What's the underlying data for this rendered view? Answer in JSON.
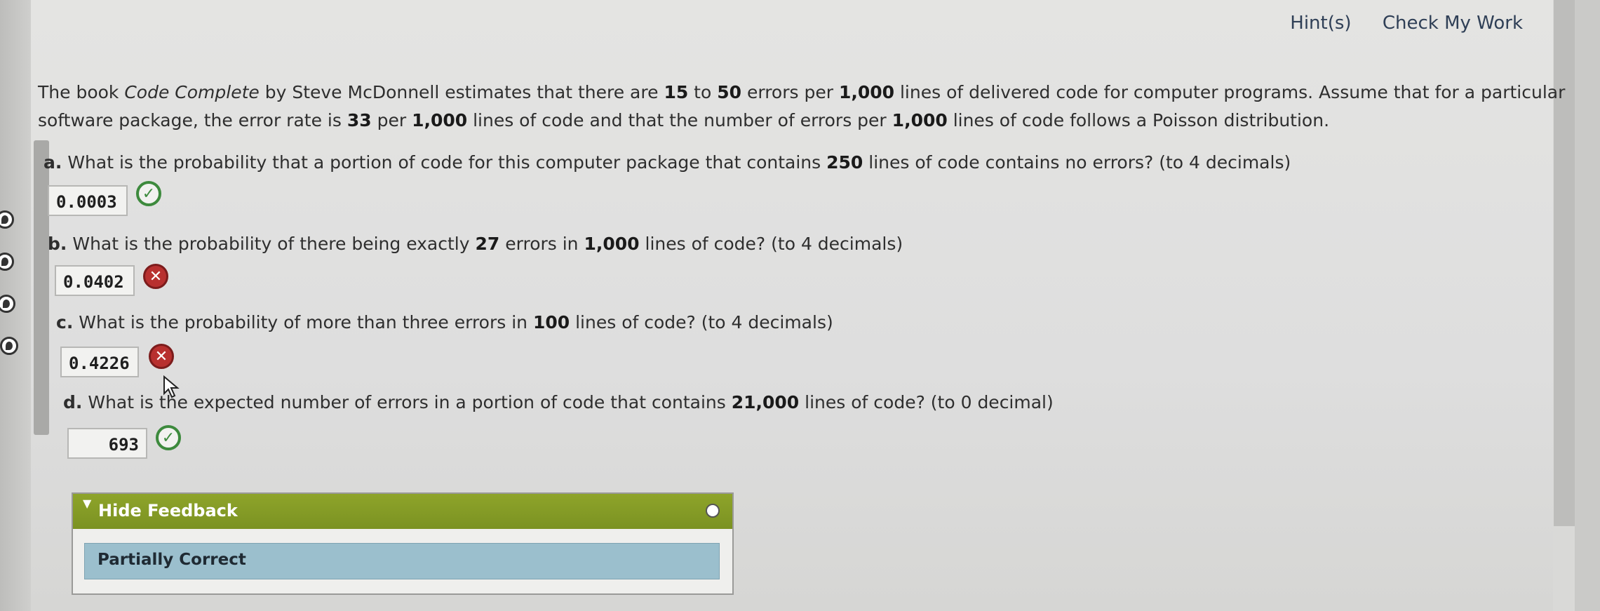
{
  "header": {
    "hints_link": "Hint(s)",
    "check_link": "Check My Work"
  },
  "problem": {
    "line1_parts": [
      "The book ",
      "Code Complete",
      " by Steve McDonnell estimates that there are ",
      "15",
      " to ",
      "50",
      " errors per ",
      "1,000",
      " lines of delivered code for computer programs. Assume that for a particular"
    ],
    "line2_parts": [
      "software package, the error rate is ",
      "33",
      " per ",
      "1,000",
      " lines of code and that the number of errors per ",
      "1,000",
      " lines of code follows a Poisson distribution."
    ]
  },
  "questions": [
    {
      "label": "a.",
      "parts": [
        " What is the probability that a portion of code for this computer package that contains ",
        "250",
        " lines of code contains no errors? (to 4 decimals)"
      ],
      "answer": "0.0003",
      "status": "correct"
    },
    {
      "label": "b.",
      "parts": [
        " What is the probability of there being exactly ",
        "27",
        " errors in ",
        "1,000",
        " lines of code? (to 4 decimals)"
      ],
      "answer": "0.0402",
      "status": "incorrect"
    },
    {
      "label": "c.",
      "parts": [
        " What is the probability of more than three errors in ",
        "100",
        " lines of code? (to 4 decimals)"
      ],
      "answer": "0.4226",
      "status": "incorrect"
    },
    {
      "label": "d.",
      "parts": [
        " What is the expected number of errors in a portion of code that contains ",
        "21,000",
        " lines of code? (to 0 decimal)"
      ],
      "answer": "693",
      "status": "correct"
    }
  ],
  "feedback": {
    "toggle_label": "Hide Feedback",
    "result": "Partially Correct",
    "header_color": "#8ea42a",
    "result_bg": "#9bbfcd"
  },
  "colors": {
    "correct": "#3d8a3d",
    "incorrect": "#b8302f"
  }
}
